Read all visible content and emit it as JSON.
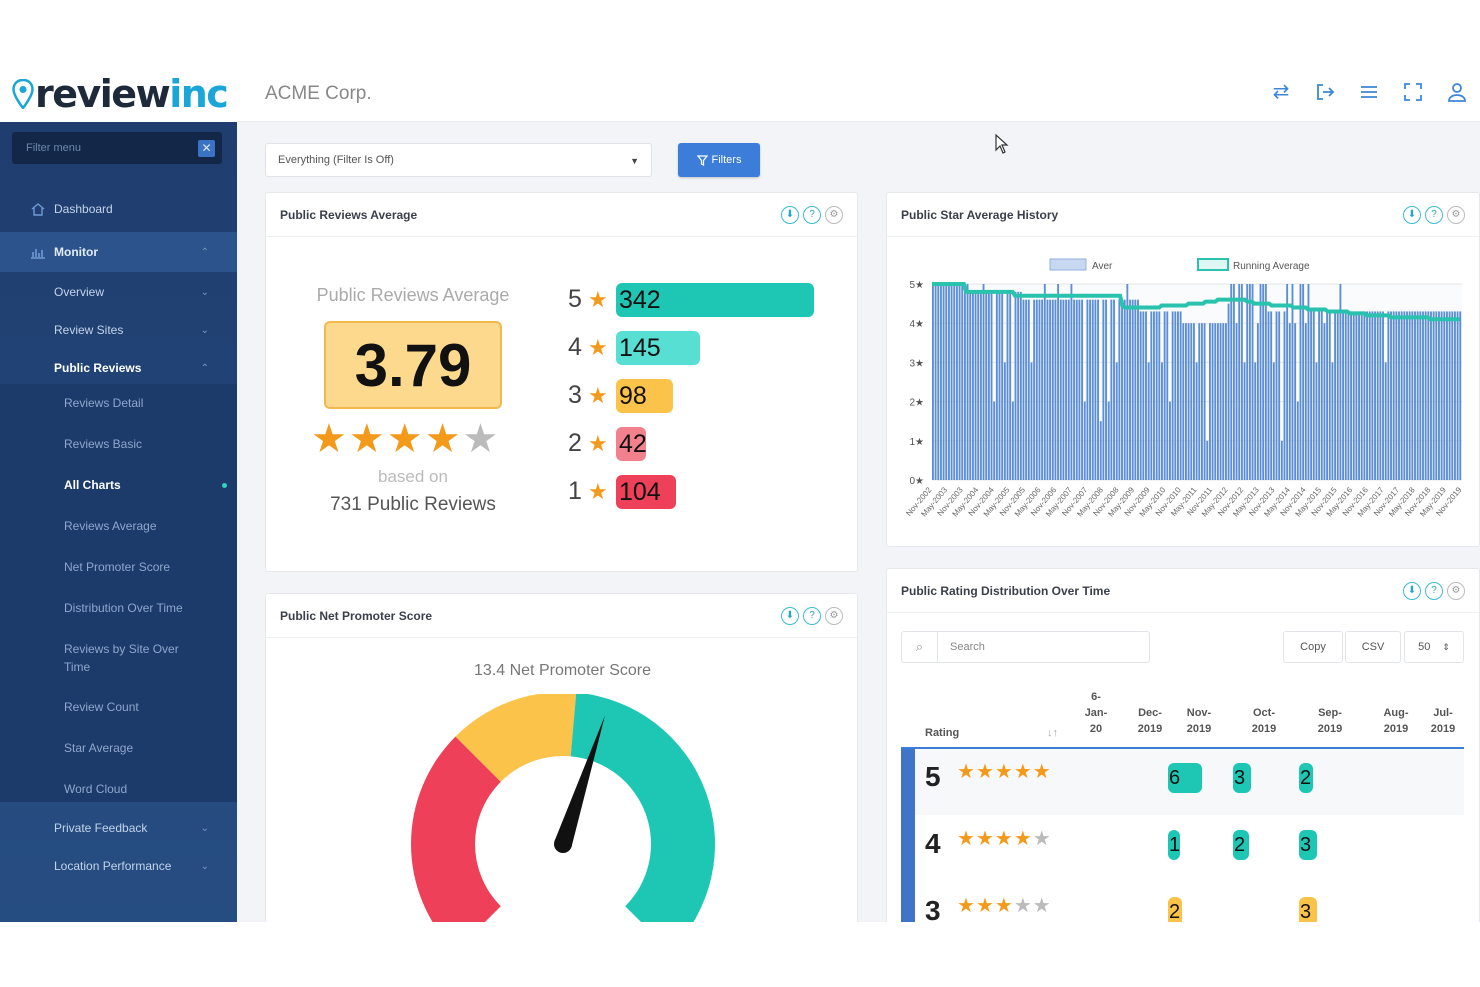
{
  "brand": {
    "logo_main": "review",
    "logo_accent": "inc"
  },
  "header": {
    "company": "ACME Corp.",
    "icons": [
      "swap-icon",
      "logout-icon",
      "menu-icon",
      "fullscreen-icon",
      "user-icon"
    ]
  },
  "sidebar": {
    "filter_placeholder": "Filter menu",
    "dashboard": "Dashboard",
    "monitor": "Monitor",
    "overview": "Overview",
    "review_sites": "Review Sites",
    "public_reviews": "Public Reviews",
    "sub": [
      "Reviews Detail",
      "Reviews Basic",
      "All Charts",
      "Reviews Average",
      "Net Promoter Score",
      "Distribution Over Time",
      "Reviews by Site Over Time",
      "Review Count",
      "Star Average",
      "Word Cloud"
    ],
    "private_feedback": "Private Feedback",
    "location_performance": "Location Performance"
  },
  "toolbar": {
    "filter_select": "Everything (Filter Is Off)",
    "filters_button": "Filters"
  },
  "avg_card": {
    "title": "Public Reviews Average",
    "subtitle": "Public Reviews Average",
    "value": "3.79",
    "rating": 3.79,
    "based_on": "based on",
    "count_text": "731 Public Reviews",
    "dist": [
      {
        "stars": "5",
        "count": "342",
        "color": "#1ec6b4"
      },
      {
        "stars": "4",
        "count": "145",
        "color": "#56dfd2"
      },
      {
        "stars": "3",
        "count": "98",
        "color": "#fbc34a"
      },
      {
        "stars": "2",
        "count": "42",
        "color": "#f2818d"
      },
      {
        "stars": "1",
        "count": "104",
        "color": "#ef4059"
      }
    ]
  },
  "history_card": {
    "title": "Public Star Average History"
  },
  "nps_card": {
    "title": "Public Net Promoter Score",
    "score_text": "13.4 Net Promoter Score",
    "score": 13.4
  },
  "dist_card": {
    "title": "Public Rating Distribution Over Time",
    "search_placeholder": "Search",
    "copy": "Copy",
    "csv": "CSV",
    "page_size": "50",
    "col_rating": "Rating",
    "sort_icon": "↓↑",
    "cols": [
      [
        "6-",
        "Jan-",
        "20"
      ],
      [
        "Dec-",
        "2019"
      ],
      [
        "Nov-",
        "2019"
      ],
      [
        "Oct-",
        "2019"
      ],
      [
        "Sep-",
        "2019"
      ],
      [
        "Aug-",
        "2019"
      ],
      [
        "Jul-",
        "2019"
      ]
    ],
    "rows": [
      {
        "rating": "5",
        "stars": 5,
        "values": [
          "6",
          "3",
          "2"
        ]
      },
      {
        "rating": "4",
        "stars": 4,
        "values": [
          "1",
          "2",
          "3"
        ]
      },
      {
        "rating": "3",
        "stars": 3,
        "values": [
          "2",
          "",
          "3"
        ]
      }
    ]
  },
  "chart_data": {
    "type": "bar",
    "title": "Public Star Average History",
    "legend": [
      "Aver",
      "Running Average"
    ],
    "legend_position": "top",
    "ylabels": [
      "5★",
      "4★",
      "3★",
      "2★",
      "1★",
      "0★"
    ],
    "ylim": [
      0,
      5
    ],
    "xlabels": [
      "Nov-2002",
      "May-2003",
      "Nov-2003",
      "May-2004",
      "Nov-2004",
      "May-2005",
      "Nov-2005",
      "May-2006",
      "Nov-2006",
      "May-2007",
      "Nov-2007",
      "May-2008",
      "Nov-2008",
      "May-2009",
      "Nov-2009",
      "May-2010",
      "Nov-2010",
      "May-2011",
      "Nov-2011",
      "May-2012",
      "Nov-2012",
      "May-2013",
      "Nov-2013",
      "May-2014",
      "Nov-2014",
      "May-2015",
      "Nov-2015",
      "May-2016",
      "Nov-2016",
      "May-2017",
      "Nov-2017",
      "May-2018",
      "Nov-2018",
      "May-2019",
      "Nov-2019"
    ],
    "series": [
      {
        "name": "Aver",
        "values": [
          5,
          5,
          5,
          5,
          5,
          5,
          5,
          5,
          5,
          5,
          5,
          5,
          5,
          5,
          4.8,
          4.8,
          4.8,
          4.8,
          4.8,
          5,
          4.8,
          4.8,
          4.8,
          2,
          4.8,
          4.8,
          4.8,
          3,
          4.8,
          4.8,
          2,
          4.8,
          4.8,
          4.8,
          4.6,
          4.6,
          4.6,
          3,
          4.6,
          4.6,
          4.6,
          4.6,
          5,
          4.6,
          4.6,
          4.6,
          4.6,
          5,
          4.6,
          4.6,
          4.6,
          4.6,
          5,
          4.6,
          4.6,
          4.6,
          4.6,
          2,
          4.6,
          4.6,
          4.6,
          4.6,
          4.6,
          1.5,
          4.6,
          4.6,
          2,
          4.6,
          4.6,
          3,
          4.6,
          4.6,
          4.6,
          5,
          4.6,
          4.6,
          4.6,
          4.6,
          4.3,
          4.3,
          4.3,
          3,
          4.3,
          4.3,
          4.3,
          4.3,
          3,
          4.3,
          4.3,
          2,
          4.3,
          4.3,
          4.3,
          4.3,
          4,
          4,
          4,
          4,
          4,
          3,
          4,
          4,
          4,
          1,
          4,
          4,
          4,
          4,
          4,
          4,
          4,
          4.5,
          5,
          5,
          4,
          5,
          5,
          3,
          5,
          5,
          5,
          3,
          4,
          5,
          5,
          5,
          4.3,
          4.3,
          3,
          4.3,
          4.3,
          1,
          4.3,
          5,
          4,
          5,
          4,
          2,
          5,
          5,
          4,
          5,
          4.3,
          4.3,
          3,
          4.3,
          4.3,
          4,
          4.3,
          4.3,
          3,
          4.3,
          4.3,
          5,
          4.3,
          4.3,
          4.3,
          4.3,
          4.3,
          4.3,
          4.3,
          4.3,
          4.3,
          4.3,
          4.3,
          4.3,
          4.3,
          4.3,
          4.3,
          4.3,
          3,
          4.3,
          4.3,
          4.3,
          4.3,
          4.3,
          4.3,
          4.3,
          4.3,
          4.3,
          4.3,
          4.3,
          4.3,
          4.3,
          4.3,
          4.3,
          4.3,
          4.3,
          4.3,
          4.3,
          4.3,
          4.3,
          4.3,
          4.3,
          4.3,
          4.3,
          4.3,
          4.3,
          4.3
        ]
      },
      {
        "name": "Running Average",
        "values": [
          5,
          5,
          5,
          5,
          5,
          5,
          5,
          5,
          5,
          5,
          5,
          5,
          5,
          5,
          4.8,
          4.8,
          4.8,
          4.8,
          4.8,
          4.8,
          4.8,
          4.8,
          4.8,
          4.8,
          4.8,
          4.8,
          4.8,
          4.8,
          4.8,
          4.8,
          4.8,
          4.8,
          4.8,
          4.8,
          4.7,
          4.7,
          4.7,
          4.7,
          4.7,
          4.7,
          4.7,
          4.7,
          4.7,
          4.7,
          4.7,
          4.7,
          4.7,
          4.7,
          4.7,
          4.7,
          4.7,
          4.7,
          4.7,
          4.7,
          4.7,
          4.7,
          4.7,
          4.7,
          4.7,
          4.7,
          4.7,
          4.7,
          4.7,
          4.7,
          4.7,
          4.7,
          4.7,
          4.7,
          4.7,
          4.7,
          4.7,
          4.7,
          4.7,
          4.7,
          4.7,
          4.7,
          4.7,
          4.7,
          4.45,
          4.4,
          4.4,
          4.4,
          4.4,
          4.4,
          4.4,
          4.4,
          4.4,
          4.4,
          4.4,
          4.4,
          4.4,
          4.4,
          4.4,
          4.4,
          4.45,
          4.45,
          4.45,
          4.45,
          4.45,
          4.45,
          4.45,
          4.45,
          4.45,
          4.45,
          4.45,
          4.5,
          4.5,
          4.5,
          4.5,
          4.5,
          4.5,
          4.5,
          4.55,
          4.55,
          4.55,
          4.55,
          4.55,
          4.6,
          4.6,
          4.6,
          4.6,
          4.6,
          4.6,
          4.6,
          4.6,
          4.6,
          4.6,
          4.6,
          4.6,
          4.55,
          4.55,
          4.55,
          4.5,
          4.5,
          4.5,
          4.5,
          4.5,
          4.5,
          4.5,
          4.45,
          4.45,
          4.45,
          4.45,
          4.45,
          4.45,
          4.45,
          4.45,
          4.45,
          4.4,
          4.4,
          4.4,
          4.4,
          4.4,
          4.4,
          4.35,
          4.35,
          4.35,
          4.35,
          4.35,
          4.35,
          4.35,
          4.35,
          4.3,
          4.3,
          4.3,
          4.3,
          4.3,
          4.3,
          4.3,
          4.3,
          4.3,
          4.25,
          4.25,
          4.25,
          4.25,
          4.25,
          4.25,
          4.25,
          4.2,
          4.2,
          4.2,
          4.2,
          4.2,
          4.2,
          4.2,
          4.2,
          4.2,
          4.2,
          4.15,
          4.15,
          4.15,
          4.15,
          4.15,
          4.15,
          4.15,
          4.15,
          4.15,
          4.15,
          4.15,
          4.15,
          4.15,
          4.15,
          4.15,
          4.15,
          4.1,
          4.1,
          4.1,
          4.1,
          4.1,
          4.1,
          4.1,
          4.1,
          4.1,
          4.1,
          4.1,
          4.1,
          4.1
        ]
      }
    ]
  },
  "colors": {
    "sidebar": "#234780",
    "accent": "#3b7dd8",
    "star": "#f49a1a",
    "teal": "#1ec6b4",
    "bar_blue": "#5b8ed4"
  }
}
